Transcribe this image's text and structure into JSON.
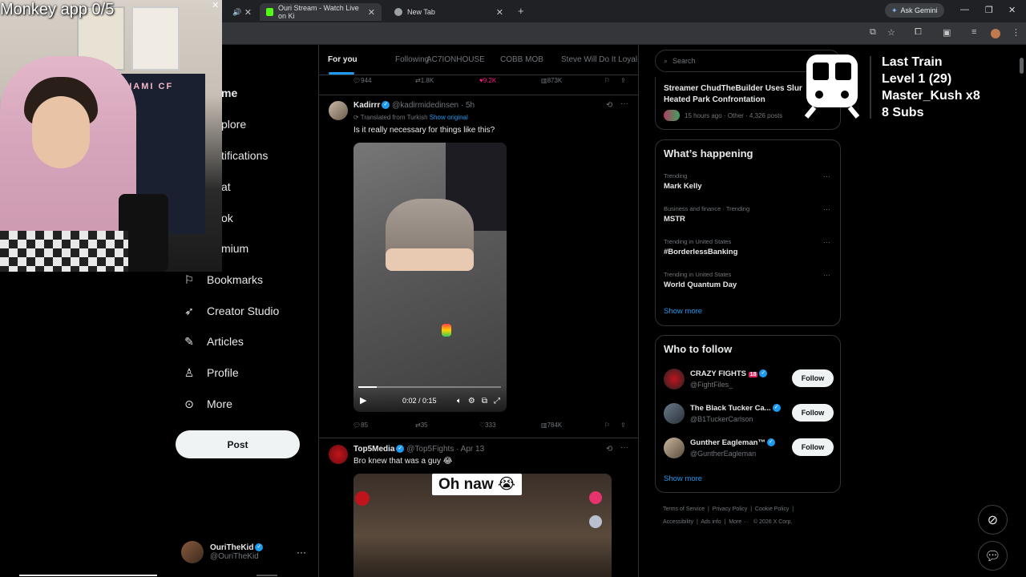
{
  "browser": {
    "tabs": [
      {
        "label": "",
        "icon": "speaker-icon"
      },
      {
        "label": "Ouri Stream - Watch Live on Ki",
        "icon": "kick-icon",
        "favicon_color": "#53fc18"
      },
      {
        "label": "New Tab",
        "icon": "chrome-icon"
      }
    ],
    "gemini_label": "Ask Gemini"
  },
  "nav": {
    "partial": [
      "me",
      "plore",
      "tifications",
      "at",
      "ok",
      "mium"
    ],
    "items": [
      {
        "label": "Bookmarks",
        "icon": "bookmark-icon"
      },
      {
        "label": "Creator Studio",
        "icon": "rocket-icon"
      },
      {
        "label": "Articles",
        "icon": "article-icon"
      },
      {
        "label": "Profile",
        "icon": "person-icon"
      },
      {
        "label": "More",
        "icon": "more-circle-icon"
      }
    ],
    "post_label": "Post",
    "account": {
      "name": "OuriTheKid",
      "handle": "@OuriTheKid"
    }
  },
  "feed": {
    "tabs": [
      "For you",
      "Following",
      "AC7IONHOUSE",
      "COBB MOB",
      "Steve Will Do It Loyal"
    ],
    "top_actions": {
      "replies": "944",
      "reposts": "1.8K",
      "likes": "9.2K",
      "views": "873K"
    },
    "tweet1": {
      "name": "Kadirrr",
      "meta": "@kadirmidedinsen · 5h",
      "translated": "Translated from Turkish",
      "show_original": "Show original",
      "text": "Is it really necessary for things like this?",
      "video_time": "0:02 / 0:15",
      "video_progress": 0.13,
      "actions": {
        "replies": "85",
        "reposts": "35",
        "likes": "333",
        "views": "784K"
      }
    },
    "tweet2": {
      "name": "Top5Media",
      "meta": "@Top5Fights · Apr 13",
      "text": "Bro knew that was a guy 😂",
      "caption": "Oh naw 😭"
    }
  },
  "sidebar": {
    "search_placeholder": "Search",
    "news": {
      "title": "Streamer ChudTheBuilder Uses Slur",
      "title2": "Heated Park Confrontation",
      "meta": "15 hours ago · Other · 4,326 posts"
    },
    "whats_happening": {
      "title": "What’s happening",
      "trends": [
        {
          "category": "Trending",
          "title": "Mark Kelly"
        },
        {
          "category": "Business and finance · Trending",
          "title": "MSTR"
        },
        {
          "category": "Trending in United States",
          "title": "#BorderlessBanking"
        },
        {
          "category": "Trending in United States",
          "title": "World Quantum Day"
        }
      ],
      "show_more": "Show more"
    },
    "who_to_follow": {
      "title": "Who to follow",
      "accounts": [
        {
          "name": "CRAZY FIGHTS",
          "badge": "18",
          "handle": "@FightFiles_"
        },
        {
          "name": "The Black Tucker Ca...",
          "handle": "@B1TuckerCarlson"
        },
        {
          "name": "Gunther Eagleman™",
          "handle": "@GuntherEagleman"
        }
      ],
      "follow_label": "Follow",
      "show_more": "Show more"
    },
    "footer": [
      "Terms of Service",
      "Privacy Policy",
      "Cookie Policy",
      "Accessibility",
      "Ads info",
      "More ···",
      "© 2026 X Corp."
    ]
  },
  "overlay": {
    "monkey": "Monkey app 0/5",
    "banner_text": "INTER MIAMI CF",
    "train": [
      "Last Train",
      "Level 1  (29)",
      "Master_Kush x8",
      "8 Subs"
    ]
  },
  "colors": {
    "accent": "#1d9bf0",
    "like": "#f91880",
    "border": "#2f3336"
  }
}
